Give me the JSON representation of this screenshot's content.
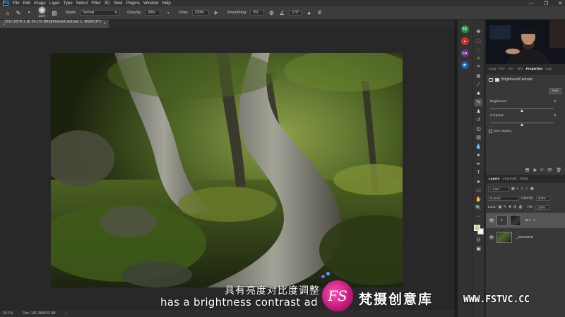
{
  "app": {
    "logo": "Ps",
    "menu": [
      "File",
      "Edit",
      "Image",
      "Layer",
      "Type",
      "Select",
      "Filter",
      "3D",
      "View",
      "Plugins",
      "Window",
      "Help"
    ],
    "window_controls": [
      "—",
      "❐",
      "✕"
    ]
  },
  "options_bar": {
    "brush_size": "1000",
    "mode_label": "Mode:",
    "mode_value": "Normal",
    "opacity_label": "Opacity:",
    "opacity_value": "30%",
    "flow_label": "Flow:",
    "flow_value": "100%",
    "smoothing_label": "Smoothing:",
    "smoothing_value": "0%",
    "angle_value": "175°"
  },
  "document": {
    "tab_title": "_DSC1878-1 @ 20.1% (Brightness/Contrast 1, RGB/16*) *",
    "zoom": "20.1%",
    "doc_size": "Doc: 141.3M/403.3M"
  },
  "properties_panel": {
    "tabs": [
      "Cont",
      "TK7",
      "TK7",
      "TK7",
      "Properties",
      "Lum"
    ],
    "active_tab": "Properties",
    "title": "Brightness/Contrast",
    "auto_label": "Auto",
    "brightness_label": "Brightness:",
    "brightness_value": "0",
    "contrast_label": "Contrast:",
    "contrast_value": "0",
    "legacy_label": "Use Legacy"
  },
  "layers_panel": {
    "tabs": [
      "Layers",
      "Channels",
      "Paths"
    ],
    "active_tab": "Layers",
    "kind_label": "Kind",
    "blend_mode": "Normal",
    "opacity_label": "Opacity:",
    "opacity_value": "100%",
    "lock_label": "Lock:",
    "fill_label": "Fill:",
    "fill_value": "100%",
    "layers": [
      {
        "name": "Bri... 1",
        "type": "adjustment",
        "selected": true
      },
      {
        "name": "_DSC1878",
        "type": "image",
        "selected": false
      }
    ]
  },
  "subtitles": {
    "chinese": "具有亮度对比度调整",
    "english": "has a brightness contrast ad"
  },
  "watermark": {
    "logo_text": "FS",
    "brand": "梵摄创意库",
    "url": "WWW.FSTVC.CC"
  }
}
